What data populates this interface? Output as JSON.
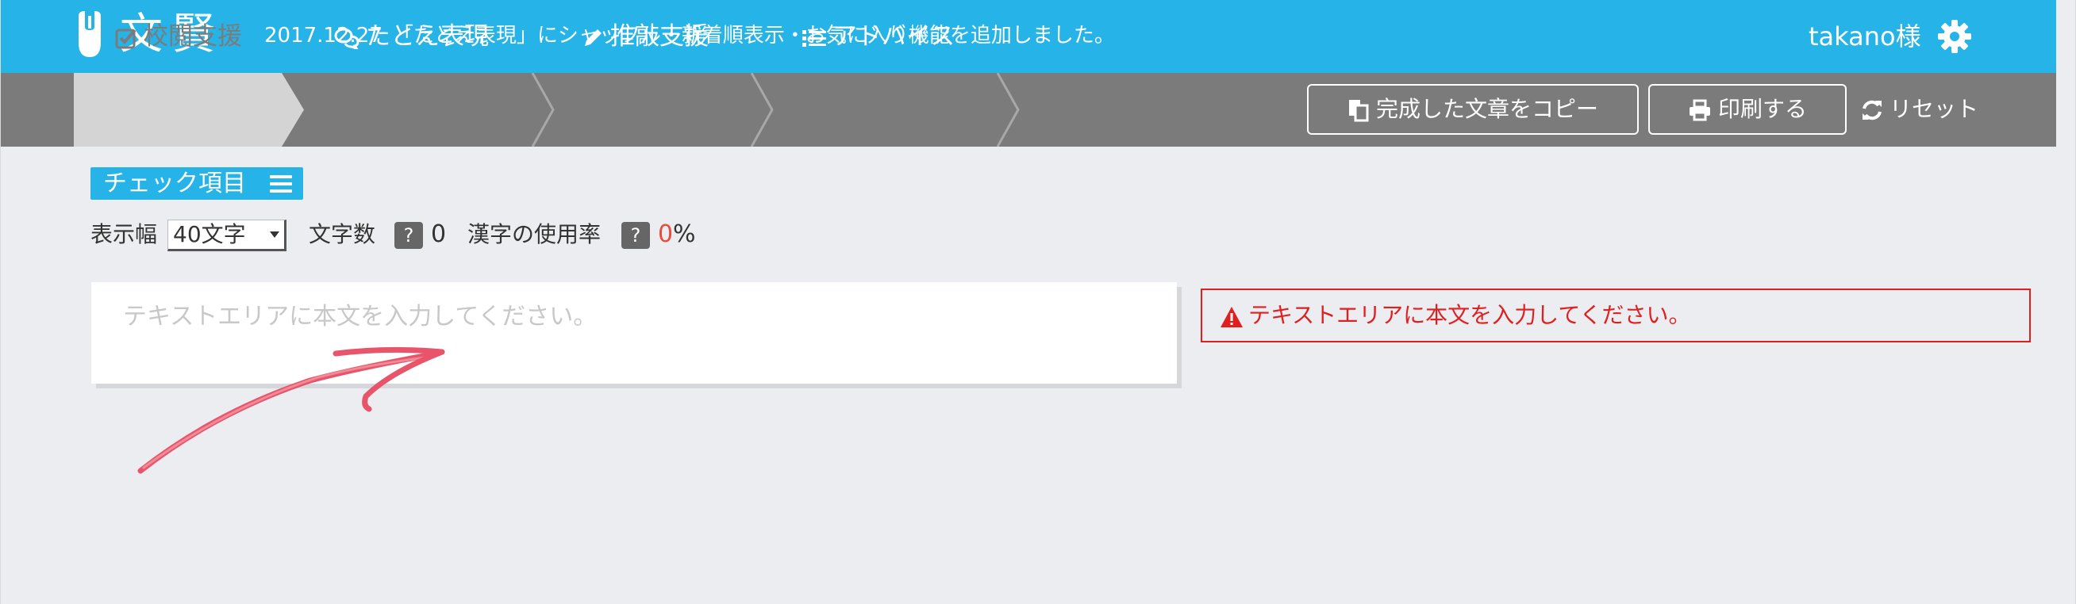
{
  "header": {
    "logo_text": "文賢",
    "news": "2017.12.27　「たとえ表現」にシャッフル・新着順表示・お気に入り機能を追加しました。",
    "user": "takano様"
  },
  "nav": {
    "steps": [
      {
        "label": "校閲支援",
        "icon": "check-square-icon",
        "active": true
      },
      {
        "label": "たとえ表現",
        "icon": "comments-icon",
        "active": false
      },
      {
        "label": "推敲支援",
        "icon": "pencil-icon",
        "active": false
      },
      {
        "label": "アドバイス",
        "icon": "list-icon",
        "active": false
      }
    ],
    "copy_label": "完成した文章をコピー",
    "print_label": "印刷する",
    "reset_label": "リセット"
  },
  "check": {
    "badge_label": "チェック項目"
  },
  "controls": {
    "width_label": "表示幅",
    "width_value": "40文字",
    "char_count_label": "文字数",
    "char_count_help": "?",
    "char_count_value": "0",
    "kanji_label": "漢字の使用率",
    "kanji_help": "?",
    "kanji_value": "0",
    "kanji_unit": "%"
  },
  "editor": {
    "placeholder": "テキストエリアに本文を入力してください。",
    "value": ""
  },
  "alert": {
    "message": "テキストエリアに本文を入力してください。"
  },
  "colors": {
    "brand": "#26b3e8",
    "nav_bg": "#7b7b7b",
    "alert_red": "#e02020",
    "arrow_pink": "#e8556a"
  }
}
